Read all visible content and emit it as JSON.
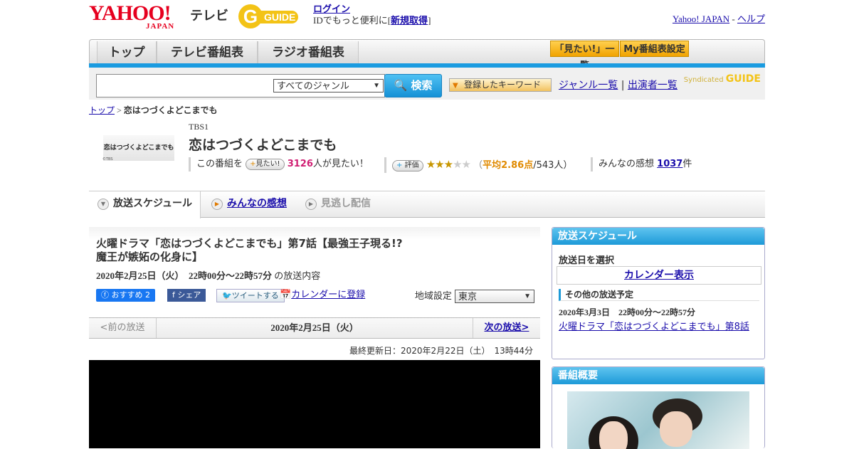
{
  "header": {
    "logo_yahoo": "YAHOO!",
    "logo_japan": "JAPAN",
    "logo_tv": "テレビ",
    "gguide_letter": "G",
    "gguide_word": "GUIDE",
    "login": "ログイン",
    "login_note_prefix": "IDでもっと便利に[",
    "register": "新規取得",
    "login_note_suffix": "]",
    "yahoo_japan": "Yahoo! JAPAN",
    "sep": "-",
    "help": "ヘルプ"
  },
  "nav": {
    "tabs": [
      "トップ",
      "テレビ番組表",
      "ラジオ番組表"
    ],
    "want_list": "「見たい!」一覧",
    "my_schedule": "My番組表設定"
  },
  "search": {
    "genre": "すべてのジャンル",
    "button": "検索",
    "keyword_button": "登録したキーワード",
    "genre_list": "ジャンル一覧",
    "divider": "|",
    "performers": "出演者一覧",
    "syndicated": "Syndicated",
    "gguide": "GUIDE"
  },
  "breadcrumb": {
    "home": "トップ",
    "sep": ">",
    "current": "恋はつづくよどこまでも"
  },
  "program": {
    "thumb_text": "恋はつづくよどこまでも",
    "thumb_sub": "©TBS",
    "station": "TBS1",
    "title": "恋はつづくよどこまでも",
    "this_program": "この番組を",
    "want_button": "見たい!",
    "want_count": "3126",
    "want_suffix": "人が見たい！",
    "rate_button": "評価",
    "rating_stars": 2.86,
    "stars_on": "★★★",
    "stars_off": "★★",
    "avg_open": "（",
    "avg_label": "平均2.86点",
    "avg_people": "/543人）",
    "reviews_label": "みんなの感想",
    "reviews_count": "1037",
    "reviews_unit": "件"
  },
  "tabs": {
    "schedule": "放送スケジュール",
    "reviews": "みんなの感想",
    "missed": "見逃し配信"
  },
  "episode": {
    "title_line1": "火曜ドラマ「恋はつづくよどこまでも」第7話【最強王子現る!?",
    "title_line2": "魔王が嫉妬の化身に】",
    "date": "2020年2月25日（火）　22時00分～22時57分",
    "date_suffix": "の放送内容",
    "fb_recommend": "おすすめ 2",
    "fb_share": "シェア",
    "tweet": "ツイートする",
    "calendar": "カレンダーに登録",
    "region_label": "地域設定",
    "region": "東京"
  },
  "pager": {
    "prev": "<前の放送",
    "current": "2020年2月25日（火）",
    "next": "次の放送>"
  },
  "updated": "最終更新日：2020年2月22日（土）　13時44分",
  "sidebar": {
    "schedule_head": "放送スケジュール",
    "select_date": "放送日を選択",
    "calendar_show": "カレンダー表示",
    "other_head": "その他の放送予定",
    "other_date": "2020年3月3日　22時00分～22時57分",
    "other_link": "火曜ドラマ「恋はつづくよどこまでも」第8話",
    "overview_head": "番組概要"
  },
  "colors": {
    "accent": "#1a9be0",
    "link": "#1a0dab",
    "yahoo_red": "#e6001f",
    "gguide_yellow": "#f3c316",
    "want_pink": "#d01e73"
  }
}
